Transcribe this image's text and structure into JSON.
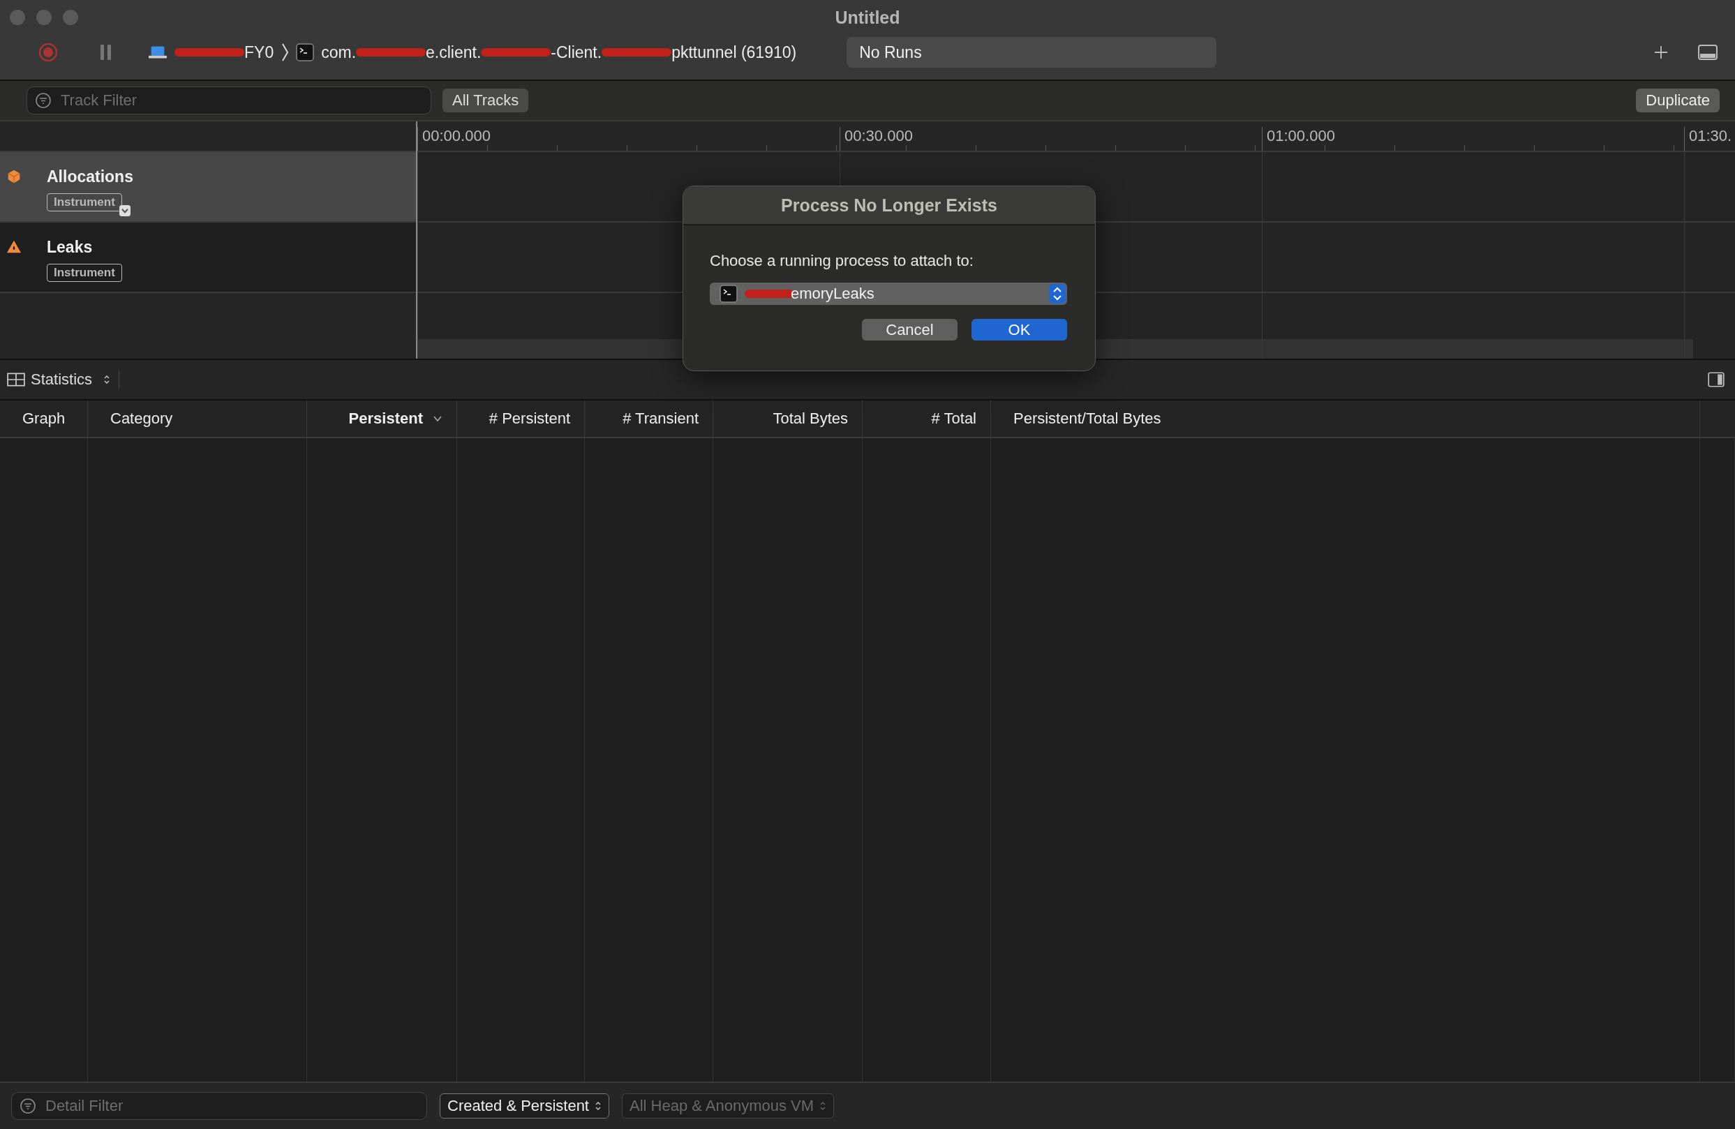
{
  "window": {
    "title": "Untitled"
  },
  "toolbar": {
    "device": "FY0",
    "target_parts": [
      "com.",
      "e.client.",
      "-Client.",
      "pkttunnel (61910)"
    ],
    "runs": "No Runs"
  },
  "filter_bar": {
    "track_filter_placeholder": "Track Filter",
    "all_tracks": "All Tracks",
    "duplicate": "Duplicate"
  },
  "timeline": {
    "ticks": [
      "00:00.000",
      "00:30.000",
      "01:00.000",
      "01:30."
    ]
  },
  "tracks": [
    {
      "name": "Allocations",
      "tag": "Instrument",
      "kind": "allocations",
      "selected": true
    },
    {
      "name": "Leaks",
      "tag": "Instrument",
      "kind": "leaks",
      "selected": false
    }
  ],
  "detail": {
    "view": "Statistics",
    "columns": [
      {
        "label": "Graph",
        "kind": "text",
        "sorted": false
      },
      {
        "label": "Category",
        "kind": "text",
        "sorted": false
      },
      {
        "label": "Persistent",
        "kind": "numeric",
        "sorted": true
      },
      {
        "label": "# Persistent",
        "kind": "numeric",
        "sorted": false
      },
      {
        "label": "# Transient",
        "kind": "numeric",
        "sorted": false
      },
      {
        "label": "Total Bytes",
        "kind": "numeric",
        "sorted": false
      },
      {
        "label": "# Total",
        "kind": "numeric",
        "sorted": false
      },
      {
        "label": "Persistent/Total Bytes",
        "kind": "text",
        "sorted": false
      }
    ]
  },
  "bottom_bar": {
    "detail_filter_placeholder": "Detail Filter",
    "mode": "Created & Persistent",
    "heap": "All Heap & Anonymous VM",
    "heap_disabled": true
  },
  "dialog": {
    "title": "Process No Longer Exists",
    "message": "Choose a running process to attach to:",
    "process": "emoryLeaks",
    "buttons": [
      {
        "label": "Cancel",
        "default": false
      },
      {
        "label": "OK",
        "default": true
      }
    ]
  }
}
